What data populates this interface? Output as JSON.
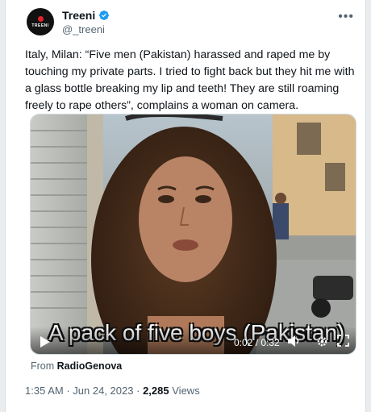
{
  "author": {
    "display_name": "Treeni",
    "handle": "@_treeni",
    "avatar_text": "TREENI"
  },
  "tweet": {
    "text": "Italy, Milan: “Five men (Pakistan) harassed and raped me by touching my private parts. I tried to fight back but they hit me with a glass bottle breaking my lip and teeth! They are still roaming freely to rape others”, complains a woman on camera."
  },
  "video": {
    "caption": "A pack of five boys (Pakistan)",
    "time": "0:02 / 0:32",
    "progress": 0.0625
  },
  "attribution": {
    "prefix": "From",
    "source": "RadioGenova"
  },
  "meta": {
    "time": "1:35 AM",
    "separator1": "·",
    "date": "Jun 24, 2023",
    "separator2": "·",
    "views_count": "2,285",
    "views_label": "Views"
  },
  "icons": {
    "verified": "verified-badge-icon",
    "more": "more-options-icon",
    "play": "play-icon",
    "volume": "volume-icon",
    "captions": "captions-icon",
    "settings": "settings-gear-icon",
    "fullscreen": "fullscreen-icon"
  },
  "colors": {
    "verified_blue": "#1d9bf0",
    "text_primary": "#0f1419",
    "text_secondary": "#536471"
  }
}
